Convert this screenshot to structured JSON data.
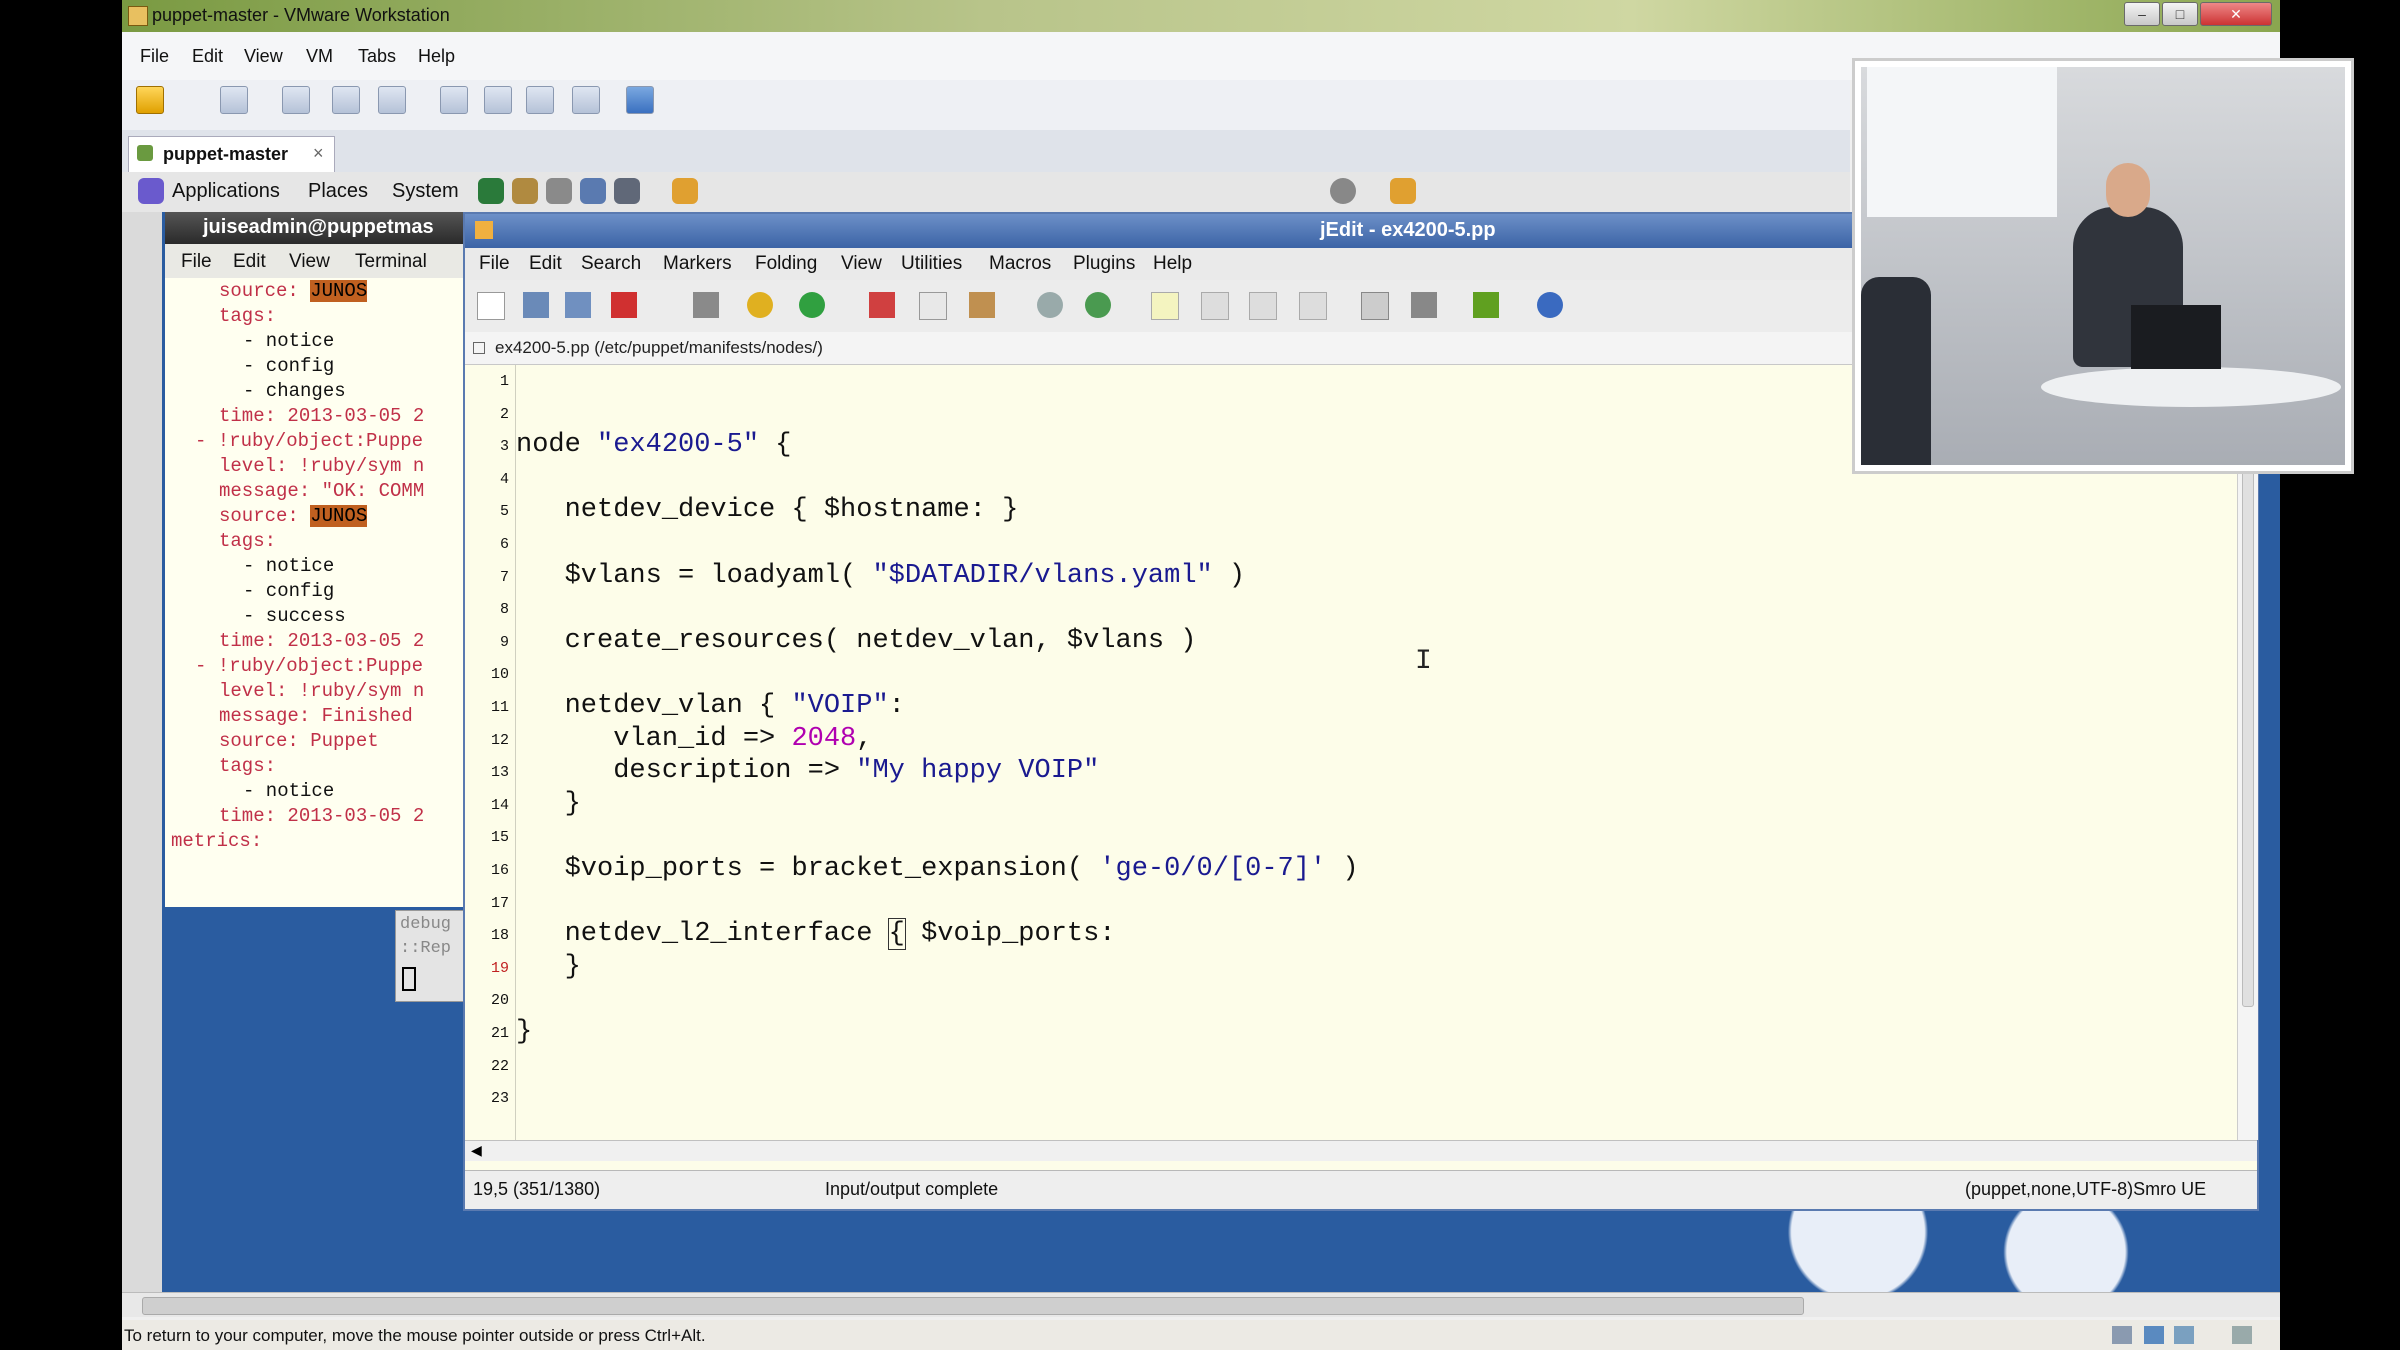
{
  "vmware": {
    "title": "puppet-master - VMware Workstation",
    "menu": [
      "File",
      "Edit",
      "View",
      "VM",
      "Tabs",
      "Help"
    ],
    "tab_label": "puppet-master",
    "tab_close": "×",
    "status": "To return to your computer, move the mouse pointer outside or press Ctrl+Alt."
  },
  "guest_panel": {
    "items": [
      "Applications",
      "Places",
      "System"
    ]
  },
  "terminal": {
    "title": "juiseadmin@puppetmas",
    "menu": [
      "File",
      "Edit",
      "View",
      "Terminal"
    ],
    "lines": [
      {
        "text": "source: ",
        "hl": "JUNOS",
        "indent": 80,
        "kind": "k"
      },
      {
        "text": "tags:",
        "indent": 80,
        "kind": "k"
      },
      {
        "text": "- notice",
        "indent": 104,
        "kind": "w"
      },
      {
        "text": "- config",
        "indent": 104,
        "kind": "w"
      },
      {
        "text": "- changes",
        "indent": 104,
        "kind": "w"
      },
      {
        "text": "time: 2013-03-05 2",
        "indent": 80,
        "kind": "k"
      },
      {
        "text": "- !ruby/object:Puppe",
        "indent": 56,
        "kind": "k"
      },
      {
        "text": "level: !ruby/sym n",
        "indent": 80,
        "kind": "k"
      },
      {
        "text": "message: \"OK: COMM",
        "indent": 80,
        "kind": "k"
      },
      {
        "text": "source: ",
        "hl": "JUNOS",
        "indent": 80,
        "kind": "k"
      },
      {
        "text": "tags:",
        "indent": 80,
        "kind": "k"
      },
      {
        "text": "- notice",
        "indent": 104,
        "kind": "w"
      },
      {
        "text": "- config",
        "indent": 104,
        "kind": "w"
      },
      {
        "text": "- success",
        "indent": 104,
        "kind": "w"
      },
      {
        "text": "time: 2013-03-05 2",
        "indent": 80,
        "kind": "k"
      },
      {
        "text": "- !ruby/object:Puppe",
        "indent": 56,
        "kind": "k"
      },
      {
        "text": "level: !ruby/sym n",
        "indent": 80,
        "kind": "k"
      },
      {
        "text": "message: Finished",
        "indent": 80,
        "kind": "k"
      },
      {
        "text": "source: Puppet",
        "indent": 80,
        "kind": "k"
      },
      {
        "text": "tags:",
        "indent": 80,
        "kind": "k"
      },
      {
        "text": "- notice",
        "indent": 104,
        "kind": "w"
      },
      {
        "text": "time: 2013-03-05 2",
        "indent": 80,
        "kind": "k"
      },
      {
        "text": "metrics:",
        "indent": 32,
        "kind": "k"
      }
    ],
    "debug_lines": [
      "debug",
      "::Rep"
    ]
  },
  "jedit": {
    "title": "jEdit - ex4200-5.pp",
    "menu": [
      "File",
      "Edit",
      "Search",
      "Markers",
      "Folding",
      "View",
      "Utilities",
      "Macros",
      "Plugins",
      "Help"
    ],
    "buffer_path": "ex4200-5.pp (/etc/puppet/manifests/nodes/)",
    "status_position": "19,5 (351/1380)",
    "status_message": "Input/output complete",
    "status_mode": "(puppet,none,UTF-8)Smro UE",
    "code_lines": [
      [],
      [],
      [
        [
          "node ",
          "p"
        ],
        [
          "\"ex4200-5\"",
          "s"
        ],
        [
          " {",
          "p"
        ]
      ],
      [],
      [
        [
          "   netdev_device { $hostname: }",
          "p"
        ]
      ],
      [],
      [
        [
          "   $vlans = loadyaml( ",
          "p"
        ],
        [
          "\"$DATADIR/vlans.yaml\"",
          "s"
        ],
        [
          " )",
          "p"
        ]
      ],
      [],
      [
        [
          "   create_resources( netdev_vlan, $vlans )",
          "p"
        ]
      ],
      [],
      [
        [
          "   netdev_vlan { ",
          "p"
        ],
        [
          "\"VOIP\"",
          "s"
        ],
        [
          ":",
          "p"
        ]
      ],
      [
        [
          "      vlan_id => ",
          "p"
        ],
        [
          "2048",
          "n"
        ],
        [
          ",",
          "p"
        ]
      ],
      [
        [
          "      description => ",
          "p"
        ],
        [
          "\"My happy VOIP\"",
          "s"
        ]
      ],
      [
        [
          "   }",
          "p"
        ]
      ],
      [],
      [
        [
          "   $voip_ports = bracket_expansion( ",
          "p"
        ],
        [
          "'ge-0/0/[0-7]'",
          "s"
        ],
        [
          " )",
          "p"
        ]
      ],
      [],
      [
        [
          "   netdev_l2_interface ",
          "p"
        ],
        [
          "{",
          "c"
        ],
        [
          " $voip_ports:",
          "p"
        ]
      ],
      [
        [
          "   }",
          "p"
        ]
      ],
      [],
      [
        [
          "}",
          "p"
        ]
      ],
      [],
      []
    ]
  },
  "colors": {
    "desktop": "#2a5ca0",
    "editor_bg": "#fdfde9",
    "string": "#1a1a90",
    "number": "#b000b0",
    "terminal_key": "#c03048",
    "highlight": "#c06020"
  }
}
